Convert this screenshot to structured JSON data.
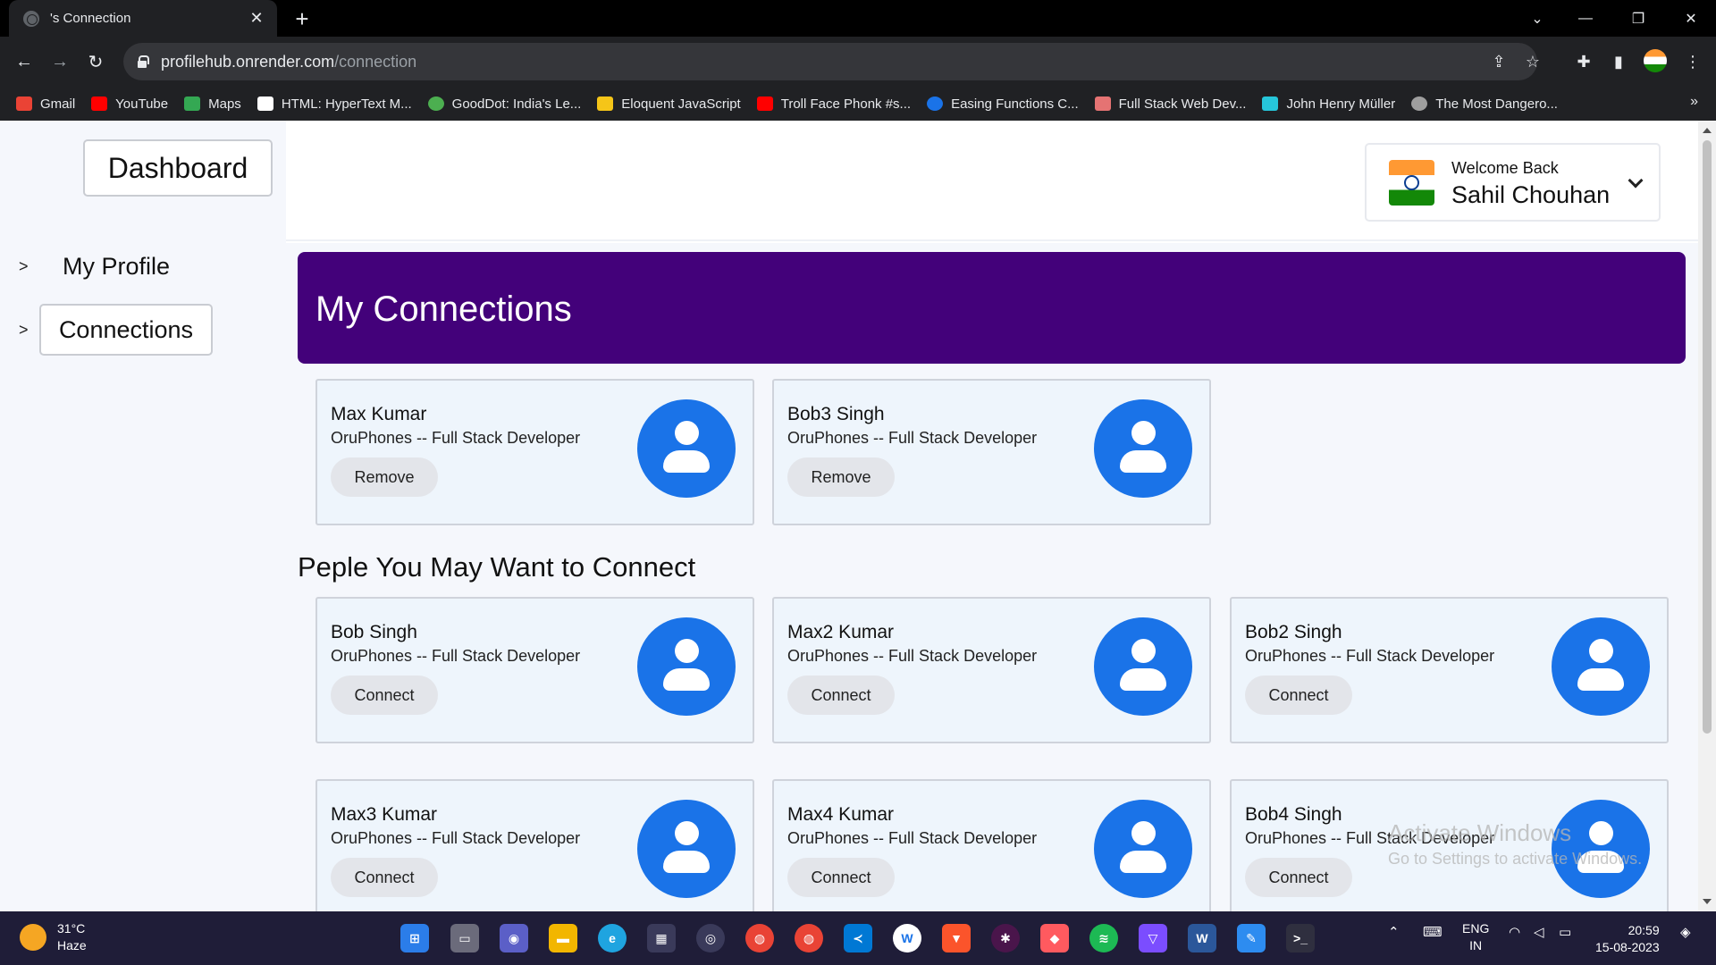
{
  "browser": {
    "tab_title": "'s Connection",
    "url_host": "profilehub.onrender.com",
    "url_path": "/connection",
    "bookmarks": [
      {
        "label": "Gmail",
        "color": "#ea4335"
      },
      {
        "label": "YouTube",
        "color": "#ff0000"
      },
      {
        "label": "Maps",
        "color": "#34a853"
      },
      {
        "label": "HTML: HyperText M...",
        "color": "#ffffff"
      },
      {
        "label": "GoodDot: India's Le...",
        "color": "#4caf50"
      },
      {
        "label": "Eloquent JavaScript",
        "color": "#f5c518"
      },
      {
        "label": "Troll Face Phonk #s...",
        "color": "#ff0000"
      },
      {
        "label": "Easing Functions C...",
        "color": "#1a73e8"
      },
      {
        "label": "Full Stack Web Dev...",
        "color": "#e57373"
      },
      {
        "label": "John Henry Müller",
        "color": "#26c6da"
      },
      {
        "label": "The Most Dangero...",
        "color": "#9e9e9e"
      }
    ]
  },
  "sidebar": {
    "dashboard": "Dashboard",
    "items": [
      {
        "arrow": ">",
        "label": "My Profile"
      },
      {
        "arrow": ">",
        "label": "Connections"
      }
    ]
  },
  "user": {
    "welcome": "Welcome Back",
    "name": "Sahil Chouhan"
  },
  "main": {
    "banner_title": "My Connections",
    "connections": [
      {
        "name": "Max Kumar",
        "role": "OruPhones -- Full Stack Developer",
        "action": "Remove"
      },
      {
        "name": "Bob3 Singh",
        "role": "OruPhones -- Full Stack Developer",
        "action": "Remove"
      }
    ],
    "suggest_title": "Peple You May Want to Connect",
    "suggestions": [
      {
        "name": "Bob Singh",
        "role": "OruPhones -- Full Stack Developer",
        "action": "Connect"
      },
      {
        "name": "Max2 Kumar",
        "role": "OruPhones -- Full Stack Developer",
        "action": "Connect"
      },
      {
        "name": "Bob2 Singh",
        "role": "OruPhones -- Full Stack Developer",
        "action": "Connect"
      },
      {
        "name": "Max3 Kumar",
        "role": "OruPhones -- Full Stack Developer",
        "action": "Connect"
      },
      {
        "name": "Max4 Kumar",
        "role": "OruPhones -- Full Stack Developer",
        "action": "Connect"
      },
      {
        "name": "Bob4 Singh",
        "role": "OruPhones -- Full Stack Developer",
        "action": "Connect"
      }
    ]
  },
  "watermark": {
    "line1": "Activate Windows",
    "line2": "Go to Settings to activate Windows."
  },
  "taskbar": {
    "temp": "31°C",
    "condition": "Haze",
    "lang_top": "ENG",
    "lang_bottom": "IN",
    "time": "20:59",
    "date": "15-08-2023"
  },
  "colors": {
    "banner": "#43017a",
    "avatar": "#1a73e8",
    "card_bg": "#eef5fc",
    "page_bg": "#f5f7fc"
  }
}
